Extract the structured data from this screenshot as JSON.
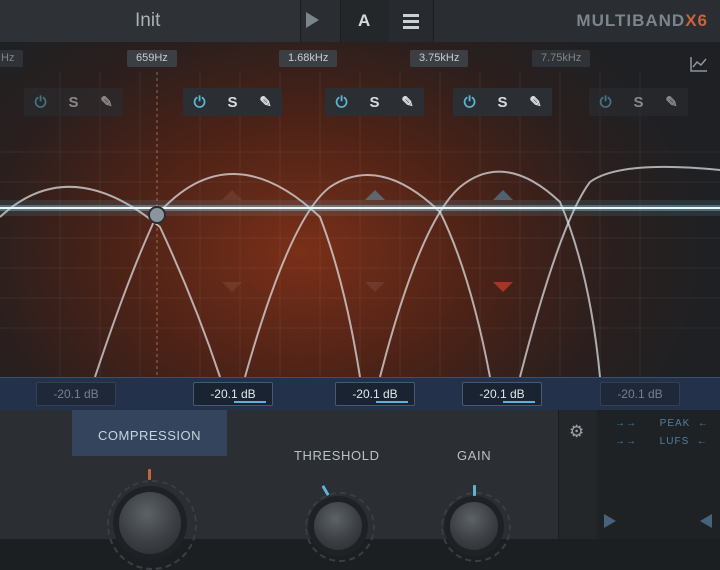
{
  "header": {
    "preset_name": "Init",
    "ab_label": "A",
    "brand_main": "MULTIBAND",
    "brand_accent": "X6"
  },
  "display": {
    "freq_labels": [
      "659Hz",
      "1.68kHz",
      "3.75kHz",
      "7.75kHz"
    ],
    "band_buttons": {
      "solo": "S"
    },
    "gains": [
      "-20.1 dB",
      "-20.1 dB",
      "-20.1 dB",
      "-20.1 dB",
      "-20.1 dB"
    ]
  },
  "bottom": {
    "tab": "COMPRESSION",
    "threshold_label": "THRESHOLD",
    "gain_label": "GAIN",
    "meter_rows": [
      "PEAK",
      "LUFS"
    ]
  },
  "colors": {
    "accent_blue": "#5fb2d6",
    "accent_orange": "#c9633b",
    "marker_red": "#c0392b"
  },
  "icons": [
    "play-icon",
    "menu-icon",
    "power-icon",
    "edit-icon",
    "graph-icon",
    "gear-icon"
  ]
}
